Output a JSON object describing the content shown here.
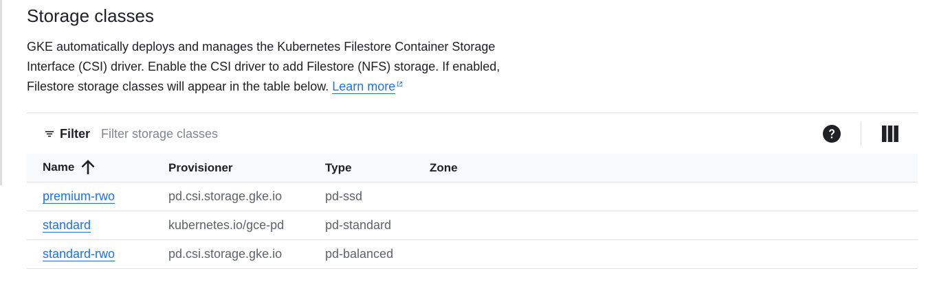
{
  "section": {
    "title": "Storage classes",
    "description_lines": [
      "GKE automatically deploys and manages the Kubernetes Filestore Container Storage",
      "Interface (CSI) driver. Enable the CSI driver to add Filestore (NFS) storage. If enabled,",
      "Filestore storage classes will appear in the table below."
    ],
    "learn_more_label": "Learn more",
    "learn_more_icon": "external-link-icon"
  },
  "toolbar": {
    "filter_label": "Filter",
    "filter_icon": "filter-icon",
    "filter_placeholder": "Filter storage classes",
    "filter_value": "",
    "help_icon": "help-icon",
    "columns_icon": "column-display-options-icon"
  },
  "table": {
    "columns": [
      {
        "label": "Name",
        "sort": "ascending",
        "sort_icon": "arrow-up-icon"
      },
      {
        "label": "Provisioner"
      },
      {
        "label": "Type"
      },
      {
        "label": "Zone"
      }
    ],
    "rows": [
      {
        "name": "premium-rwo",
        "provisioner": "pd.csi.storage.gke.io",
        "type": "pd-ssd",
        "zone": ""
      },
      {
        "name": "standard",
        "provisioner": "kubernetes.io/gce-pd",
        "type": "pd-standard",
        "zone": ""
      },
      {
        "name": "standard-rwo",
        "provisioner": "pd.csi.storage.gke.io",
        "type": "pd-balanced",
        "zone": ""
      }
    ]
  },
  "colors": {
    "link": "#1a73e8",
    "text": "#202124",
    "muted": "#5f6368",
    "header_bg": "#f8f9fa",
    "divider": "#e0e0e0"
  }
}
